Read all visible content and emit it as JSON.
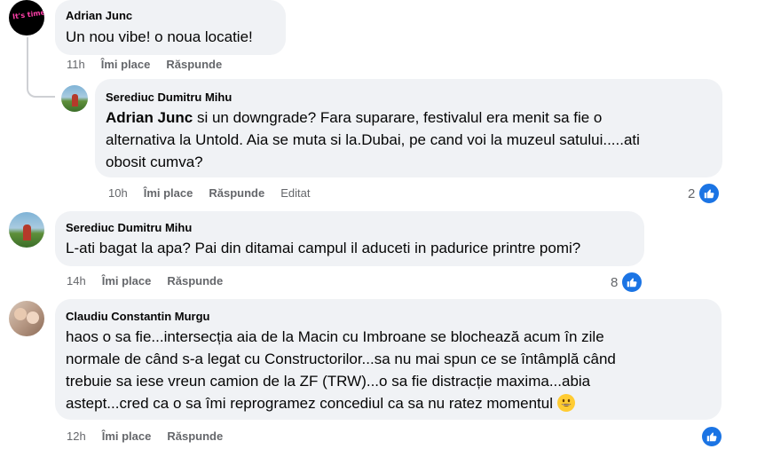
{
  "comments": [
    {
      "author": "Adrian Junc",
      "avatar_text": "It's time",
      "text": "Un nou vibe! o noua locatie!",
      "time": "11h",
      "like_label": "Îmi place",
      "reply_label": "Răspunde"
    },
    {
      "author": "Serediuc Dumitru Mihu",
      "mention": "Adrian Junc",
      "text_line1": " si un downgrade? Fara suparare, festivalul era menit sa fie o",
      "text_line2": "alternativa la Untold. Aia se muta si la.Dubai, pe cand voi la muzeul satului.....ati",
      "text_line3": "obosit cumva?",
      "time": "10h",
      "like_label": "Îmi place",
      "reply_label": "Răspunde",
      "edited_label": "Editat",
      "reaction_count": "2"
    },
    {
      "author": "Serediuc Dumitru Mihu",
      "text": "L-ati bagat la apa? Pai din ditamai campul il aduceti in padurice printre pomi?",
      "time": "14h",
      "like_label": "Îmi place",
      "reply_label": "Răspunde",
      "reaction_count": "8"
    },
    {
      "author": "Claudiu Constantin Murgu",
      "text_line1": "haos o sa fie...intersecția aia de la Macin cu Imbroane se blochează acum în zile",
      "text_line2": "normale de când s-a legat cu Constructorilor...sa nu mai spun ce se întâmplă când",
      "text_line3": "trebuie sa iese vreun camion de la ZF (TRW)...o sa fie distracție maxima...abia",
      "text_line4": "astept...cred ca o sa îmi reprogramez concediul ca sa nu ratez momentul",
      "time": "12h",
      "like_label": "Îmi place",
      "reply_label": "Răspunde"
    }
  ],
  "colors": {
    "bubble": "#f0f2f5",
    "meta": "#65676b",
    "like_blue": "#1b74e4",
    "thread_line": "#ced0d4"
  },
  "icons": {
    "like": "thumbs-up-icon",
    "emoji": "grinning-face-emoji"
  }
}
